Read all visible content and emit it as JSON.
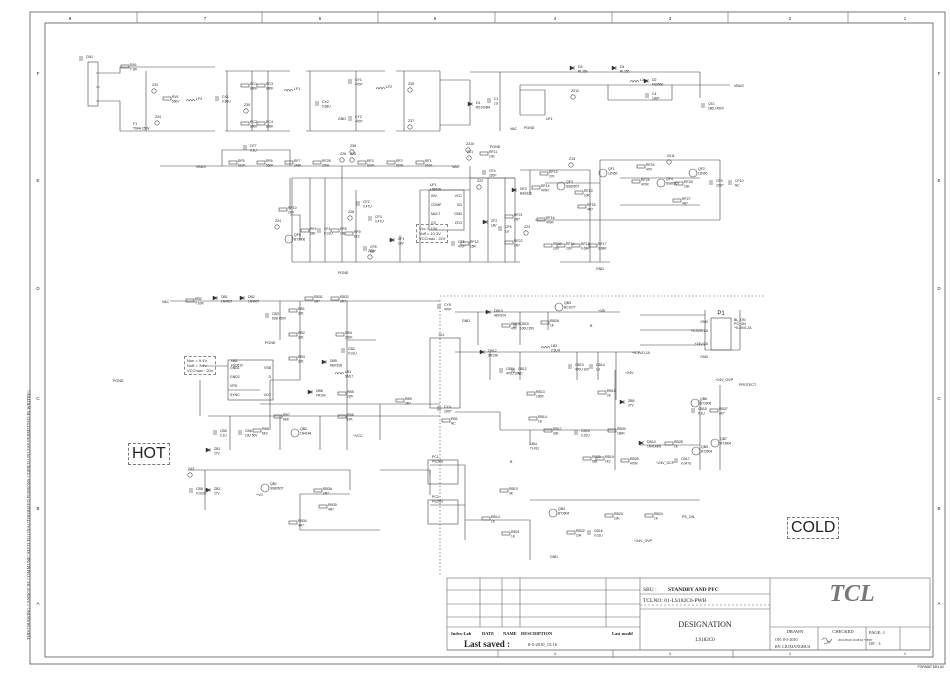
{
  "frame": {
    "columns": [
      "8",
      "7",
      "6",
      "5",
      "4",
      "3",
      "2",
      "1"
    ],
    "rows": [
      "F",
      "E",
      "D",
      "C",
      "B",
      "A"
    ],
    "bottom_columns": [
      "4",
      "3",
      "2",
      "1"
    ],
    "side_note": "THIS DRAWING CANNOT BE COMMUNICATED TO UNAUTHORIZED PERSONS COPIED UNLESS PERMITTED IN WRITING",
    "format": "FORMAT DIN A2"
  },
  "zones": {
    "hot": "HOT",
    "cold": "COLD"
  },
  "notes": {
    "pfc": [
      "Vcc = 13V",
      "Voff = 10.3V",
      "VCCmax : 22V"
    ],
    "standby": [
      "Non = 9.4V",
      "Noff = 7.4V",
      "VCCmax : 20V"
    ]
  },
  "ic_pins": {
    "uf1_left": [
      "INV",
      "COMP",
      "MULT",
      "CS"
    ],
    "uf1_right": [
      "VCC",
      "GD",
      "GND",
      "ZCD"
    ],
    "ub1_left": [
      "GND1",
      "GND2",
      "VFB",
      "SYNC"
    ],
    "ub1_right": [
      "VSB",
      "D",
      "",
      "VCC"
    ]
  },
  "connector_p1": {
    "ref": "P1",
    "left": [
      "GND",
      "+5.3V/0.2A",
      "+24V/2A"
    ],
    "right": [
      "BL_ON",
      "PS_ON",
      "+5.3V/0.2A"
    ],
    "ground": "GND"
  },
  "nets": [
    "VBUS",
    "VAC",
    "VBUS",
    "VAC",
    "VAC",
    "PGND",
    "PGND",
    "PGND",
    "GND",
    "+VB",
    "B",
    "+5.3V/0.2A",
    "+24V",
    "+24V_OVP",
    "PROTECT",
    "+VCC",
    "+VC",
    "+24V_OCP",
    "PS_ON",
    "+24V_OVP",
    "B",
    "GND",
    "GND",
    "PGND",
    "PGND",
    "GND"
  ],
  "components": [
    {
      "ref": "CN1",
      "value": ""
    },
    {
      "ref": "RA1",
      "value": "T 3R"
    },
    {
      "ref": "Z33",
      "value": ""
    },
    {
      "ref": "RV1",
      "value": "560V"
    },
    {
      "ref": "F1",
      "value": "T6AH 250V"
    },
    {
      "ref": "Z34",
      "value": ""
    },
    {
      "ref": "LF3",
      "value": ""
    },
    {
      "ref": "CX1",
      "value": "0.68U"
    },
    {
      "ref": "RC1",
      "value": "680K"
    },
    {
      "ref": "RC3",
      "value": "680K"
    },
    {
      "ref": "RC2",
      "value": "680K"
    },
    {
      "ref": "RC4",
      "value": "680K"
    },
    {
      "ref": "Z30",
      "value": ""
    },
    {
      "ref": "LF1",
      "value": ""
    },
    {
      "ref": "CX2",
      "value": "0.68U"
    },
    {
      "ref": "CY1",
      "value": "470P"
    },
    {
      "ref": "CY2",
      "value": "470P"
    },
    {
      "ref": "Z36",
      "value": ""
    },
    {
      "ref": "LF2",
      "value": ""
    },
    {
      "ref": "Z35",
      "value": ""
    },
    {
      "ref": "Z37",
      "value": ""
    },
    {
      "ref": "D1",
      "value": "RS1006M"
    },
    {
      "ref": "C1",
      "value": "1U"
    },
    {
      "ref": "Z310",
      "value": ""
    },
    {
      "ref": "D3",
      "value": "RL256"
    },
    {
      "ref": "D4",
      "value": "RL255"
    },
    {
      "ref": "L1",
      "value": ""
    },
    {
      "ref": "D2",
      "value": "FS6560"
    },
    {
      "ref": "C4",
      "value": "100P"
    },
    {
      "ref": "Z012",
      "value": ""
    },
    {
      "ref": "UF1",
      "value": ""
    },
    {
      "ref": "CE1",
      "value": "180U 450V"
    },
    {
      "ref": "CF7",
      "value": "0.1U"
    },
    {
      "ref": "RF5",
      "value": "510K"
    },
    {
      "ref": "RF6",
      "value": "560K"
    },
    {
      "ref": "RF7",
      "value": "249K"
    },
    {
      "ref": "RF28",
      "value": "220K"
    },
    {
      "ref": "Z26",
      "value": ""
    },
    {
      "ref": "Z25",
      "value": ""
    },
    {
      "ref": "RF3",
      "value": "510K"
    },
    {
      "ref": "RF2",
      "value": "510K"
    },
    {
      "ref": "RF1",
      "value": "510K"
    },
    {
      "ref": "UF1",
      "value": "L6562D"
    },
    {
      "ref": "RF10",
      "value": "2K4"
    },
    {
      "ref": "Z24",
      "value": ""
    },
    {
      "ref": "QF5",
      "value": "BT3906"
    },
    {
      "ref": "RF4",
      "value": "56K"
    },
    {
      "ref": "CF1",
      "value": "0.01U"
    },
    {
      "ref": "RF8",
      "value": "15K"
    },
    {
      "ref": "RF9",
      "value": "6K2"
    },
    {
      "ref": "CF2",
      "value": "0.47U"
    },
    {
      "ref": "CF3",
      "value": "0.47U"
    },
    {
      "ref": "Z28",
      "value": ""
    },
    {
      "ref": "CF8",
      "value": "68P"
    },
    {
      "ref": "ZF1",
      "value": "18V"
    },
    {
      "ref": "Z27",
      "value": ""
    },
    {
      "ref": "Z21",
      "value": ""
    },
    {
      "ref": "RF11",
      "value": "10K"
    },
    {
      "ref": "CF4",
      "value": "220P"
    },
    {
      "ref": "Z22",
      "value": ""
    },
    {
      "ref": "ZF2",
      "value": "18V"
    },
    {
      "ref": "CF5",
      "value": "470P"
    },
    {
      "ref": "RF12",
      "value": "15R"
    },
    {
      "ref": "CF6",
      "value": "1U"
    },
    {
      "ref": "DF3",
      "value": "BAS316"
    },
    {
      "ref": "RF21",
      "value": "2R7"
    },
    {
      "ref": "RF22",
      "value": "2R7"
    },
    {
      "ref": "Z23",
      "value": ""
    },
    {
      "ref": "RF13",
      "value": "27K"
    },
    {
      "ref": "Z15",
      "value": ""
    },
    {
      "ref": "QF3",
      "value": "SS8050T"
    },
    {
      "ref": "RF14",
      "value": "470R"
    },
    {
      "ref": "RF23",
      "value": "10K"
    },
    {
      "ref": "QF1",
      "value": "12N50"
    },
    {
      "ref": "RF15",
      "value": "4R7"
    },
    {
      "ref": "RF16",
      "value": "470R"
    },
    {
      "ref": "RF20",
      "value": "22R"
    },
    {
      "ref": "RF19",
      "value": "22R"
    },
    {
      "ref": "RF18",
      "value": "0.68R"
    },
    {
      "ref": "RF17",
      "value": "0.68R"
    },
    {
      "ref": "RF24",
      "value": "47R"
    },
    {
      "ref": "Z011",
      "value": ""
    },
    {
      "ref": "RF25",
      "value": "470R"
    },
    {
      "ref": "QF4",
      "value": "SS8050T"
    },
    {
      "ref": "RF26",
      "value": "10K"
    },
    {
      "ref": "QF2",
      "value": "12N50"
    },
    {
      "ref": "RF27",
      "value": "4R7"
    },
    {
      "ref": "CF9",
      "value": "220P"
    },
    {
      "ref": "CF10",
      "value": "NC"
    },
    {
      "ref": "RB2",
      "value": "T 10R"
    },
    {
      "ref": "DB1",
      "value": "1N4007"
    },
    {
      "ref": "DB2",
      "value": "1N4007"
    },
    {
      "ref": "RB31",
      "value": "3R7"
    },
    {
      "ref": "RB32",
      "value": "3R7"
    },
    {
      "ref": "CB3",
      "value": "6U8 450V"
    },
    {
      "ref": "RB1",
      "value": "22K"
    },
    {
      "ref": "RB2",
      "value": "22K"
    },
    {
      "ref": "RB3",
      "value": "22K"
    },
    {
      "ref": "RB4",
      "value": "220K"
    },
    {
      "ref": "CB2",
      "value": "0.01U"
    },
    {
      "ref": "DB5",
      "value": "HER108"
    },
    {
      "ref": "UB1",
      "value": "FSQ510"
    },
    {
      "ref": "LB1",
      "value": "SML7"
    },
    {
      "ref": "DB6",
      "value": "FR104"
    },
    {
      "ref": "RB5",
      "value": "22R"
    },
    {
      "ref": "RB7",
      "value": "6K8"
    },
    {
      "ref": "RB6",
      "value": "27K"
    },
    {
      "ref": "RB9",
      "value": "2R7"
    },
    {
      "ref": "CB5",
      "value": "0.1U"
    },
    {
      "ref": "CB6",
      "value": "10U 50V"
    },
    {
      "ref": "RB8",
      "value": "6K2"
    },
    {
      "ref": "QB2",
      "value": "1N4148"
    },
    {
      "ref": "ZB1",
      "value": "27V"
    },
    {
      "ref": "Z43",
      "value": ""
    },
    {
      "ref": "CB8",
      "value": "0.022U"
    },
    {
      "ref": "ZB2",
      "value": "27V"
    },
    {
      "ref": "QB1",
      "value": "SS8050T"
    },
    {
      "ref": "RB3A",
      "value": "2R7"
    },
    {
      "ref": "RB30",
      "value": "4R7"
    },
    {
      "ref": "RB34",
      "value": "4R7"
    },
    {
      "ref": "PC1",
      "value": "PS2561"
    },
    {
      "ref": "PC2",
      "value": "PS2561"
    },
    {
      "ref": "CY5",
      "value": "470P"
    },
    {
      "ref": "DB13",
      "value": "HER104"
    },
    {
      "ref": "RB29",
      "value": "47K"
    },
    {
      "ref": "CB19",
      "value": "100U 35V"
    },
    {
      "ref": "QB3",
      "value": "BC107T"
    },
    {
      "ref": "RB26",
      "value": "1K"
    },
    {
      "ref": "TS1",
      "value": ""
    },
    {
      "ref": "DB12",
      "value": "SR158"
    },
    {
      "ref": "LB2",
      "value": "2.5UH"
    },
    {
      "ref": "CB11",
      "value": "470U 16V"
    },
    {
      "ref": "CB12",
      "value": "NC"
    },
    {
      "ref": "CB13",
      "value": "470U 16V"
    },
    {
      "ref": "CB14",
      "value": "1U"
    },
    {
      "ref": "RB13",
      "value": "100R"
    },
    {
      "ref": "RB15",
      "value": "2K"
    },
    {
      "ref": "ZB8",
      "value": "27V"
    },
    {
      "ref": "CY4",
      "value": "220P"
    },
    {
      "ref": "RB1",
      "value": "NC"
    },
    {
      "ref": "RB14",
      "value": "1K"
    },
    {
      "ref": "RB17",
      "value": "33K"
    },
    {
      "ref": "CB15",
      "value": "0.22U"
    },
    {
      "ref": "UB4",
      "value": "TL431"
    },
    {
      "ref": "RB20",
      "value": "68K"
    },
    {
      "ref": "RB19",
      "value": "1K2"
    },
    {
      "ref": "RB30",
      "value": "180R"
    },
    {
      "ref": "RB25",
      "value": "470R"
    },
    {
      "ref": "DB14",
      "value": "1N4148W"
    },
    {
      "ref": "RB28",
      "value": "1K"
    },
    {
      "ref": "CB17",
      "value": "0.047U"
    },
    {
      "ref": "QB6",
      "value": "BT3906"
    },
    {
      "ref": "QB7",
      "value": "BT3904"
    },
    {
      "ref": "QB5",
      "value": "BT3904"
    },
    {
      "ref": "RB37",
      "value": "4K7"
    },
    {
      "ref": "CB18",
      "value": "0.1U"
    },
    {
      "ref": "RB13",
      "value": "3K"
    },
    {
      "ref": "RB14",
      "value": "1K"
    },
    {
      "ref": "RB21",
      "value": "1K"
    },
    {
      "ref": "QB4",
      "value": "BT3904"
    },
    {
      "ref": "RB22",
      "value": "10K"
    },
    {
      "ref": "CB16",
      "value": "0.01U"
    },
    {
      "ref": "RB23",
      "value": "10K"
    },
    {
      "ref": "RB24",
      "value": "1K"
    }
  ],
  "title_block": {
    "headers": [
      "Index-Lab",
      "DATE",
      "NAME",
      "DESCRIPTION",
      "Last modif"
    ],
    "last_saved_label": "Last saved :",
    "last_saved": "8-5-2010_15:16",
    "sbu_label": "SBU :",
    "sbu": "STANDBY AND PFC",
    "tclno": "TCLNO: 01-LS182C0-PWB",
    "designation_label": "DESIGNATION",
    "designation": "LS182C0",
    "logo": "TCL",
    "drawn_label": "DRAWN",
    "drawn_on": "ON: 8-5-2010",
    "drawn_by": "BY: LIUXIANGHUA",
    "checked_label": "CHECKED",
    "checked_stamp": "2010.08.09 10:28:04 +08'00'",
    "page": "PAGE: 1",
    "of": "OF : 3"
  },
  "colors": {
    "ink": "#222222",
    "wire": "#444444",
    "frame": "#555555"
  }
}
